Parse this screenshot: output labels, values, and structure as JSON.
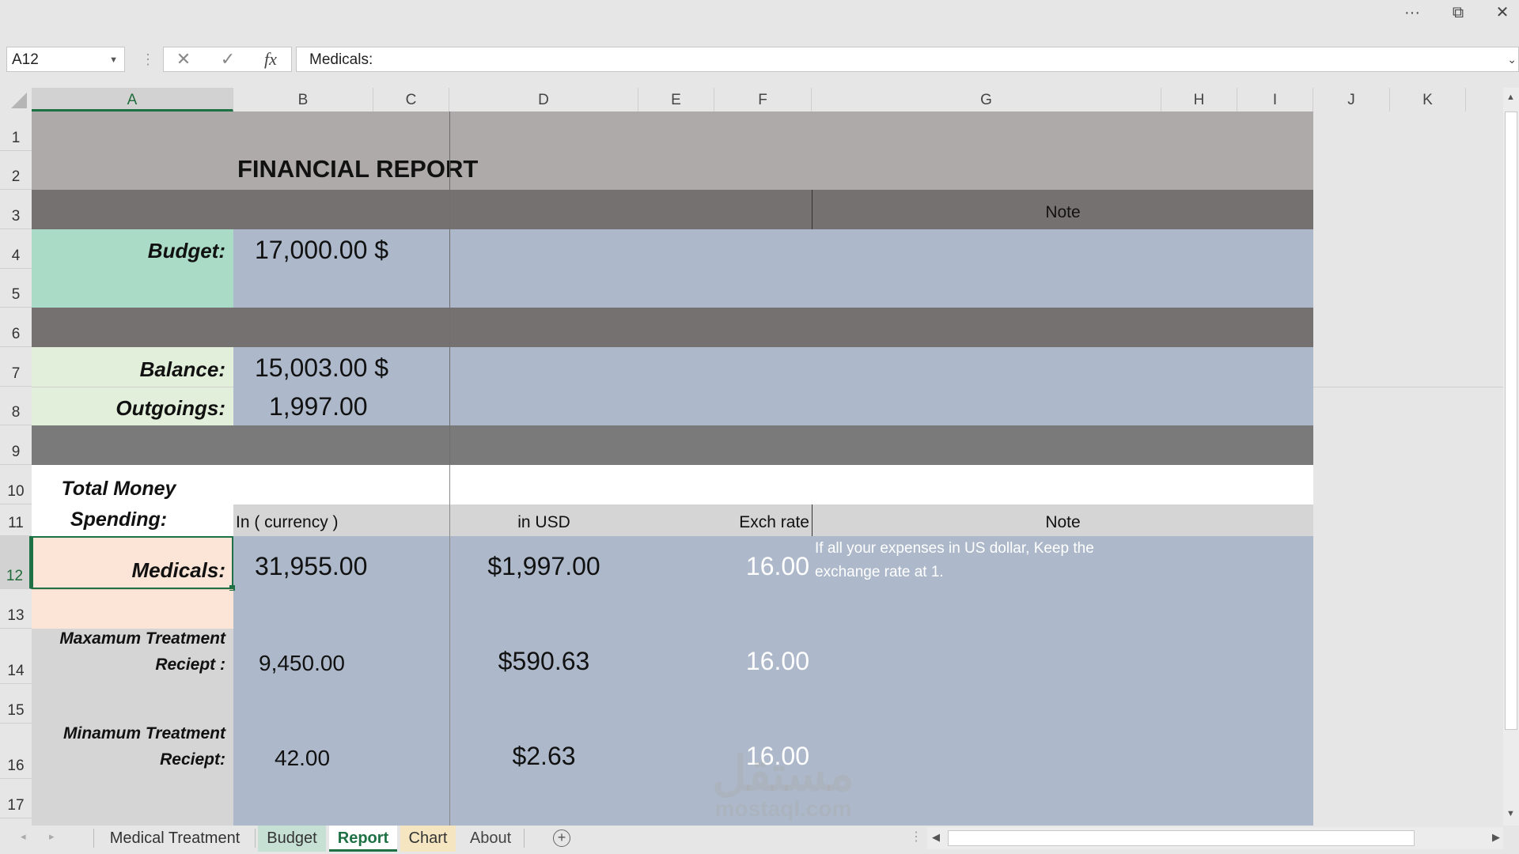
{
  "window": {
    "more_label": "···",
    "restore_label": "⧉",
    "close_label": "✕"
  },
  "formula_bar": {
    "name_box": "A12",
    "fx_label": "fx",
    "cancel_label": "✕",
    "enter_label": "✓",
    "formula": "Medicals:"
  },
  "columns": [
    "A",
    "B",
    "C",
    "D",
    "E",
    "F",
    "G",
    "H",
    "I",
    "J",
    "K"
  ],
  "rows": [
    "1",
    "2",
    "3",
    "4",
    "5",
    "6",
    "7",
    "8",
    "9",
    "10",
    "11",
    "12",
    "13",
    "14",
    "15",
    "16",
    "17"
  ],
  "report": {
    "title": "FINANCIAL REPORT",
    "note_header": "Note",
    "budget_label": "Budget:",
    "budget_value": "17,000.00 $",
    "balance_label": "Balance:",
    "balance_value": "15,003.00 $",
    "outgoings_label": "Outgoings:",
    "outgoings_value": "1,997.00",
    "total_label_1": "Total Money",
    "total_label_2": "Spending:",
    "col_currency": "In ( currency )",
    "col_usd": "in USD",
    "col_rate": "Exch rate",
    "col_note": "Note",
    "medicals_label": "Medicals:",
    "medicals_currency": "31,955.00",
    "medicals_usd": "$1,997.00",
    "medicals_rate": "16.00",
    "note_text_1": "If all your expenses in US dollar, Keep the",
    "note_text_2": "exchange rate at 1.",
    "max_label_1": "Maxamum Treatment",
    "max_label_2": "Reciept :",
    "max_currency": "9,450.00",
    "max_usd": "$590.63",
    "max_rate": "16.00",
    "min_label_1": "Minamum Treatment",
    "min_label_2": "Reciept:",
    "min_currency": "42.00",
    "min_usd": "$2.63",
    "min_rate": "16.00"
  },
  "watermark": {
    "line1": "مستقل",
    "line2": "mostaql.com"
  },
  "sheets": [
    {
      "name": "Medical Treatment"
    },
    {
      "name": "Budget"
    },
    {
      "name": "Report"
    },
    {
      "name": "Chart"
    },
    {
      "name": "About"
    }
  ],
  "colors": {
    "accent": "#1e7145",
    "bluegrey": "#adb9ca",
    "dark": "#767171",
    "light": "#aeaaaa"
  }
}
